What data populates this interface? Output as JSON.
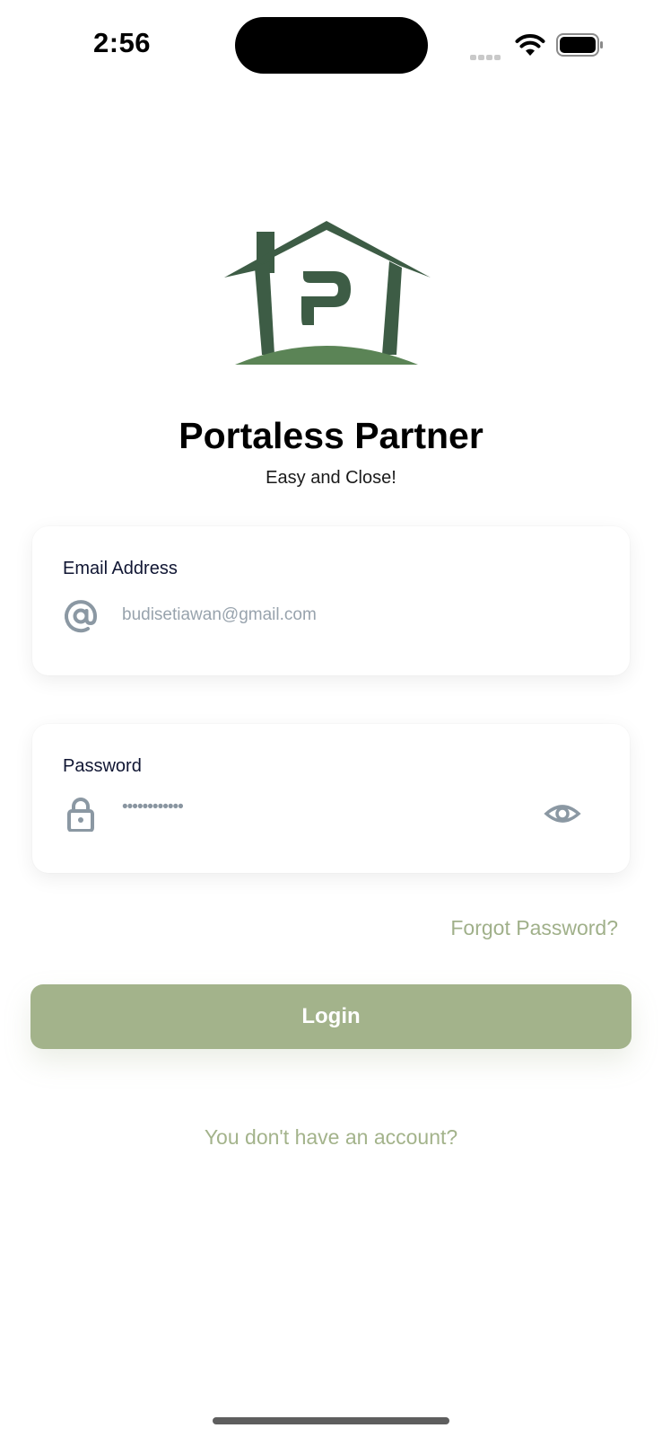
{
  "status_bar": {
    "time": "2:56",
    "wifi_icon": "wifi-icon",
    "battery_icon": "battery-icon"
  },
  "brand": {
    "title": "Portaless Partner",
    "tagline": "Easy and Close!",
    "logo_icon": "house-p-logo",
    "colors": {
      "dark_green": "#3d5c45",
      "light_green": "#5b8456",
      "accent": "#a3b38b"
    }
  },
  "email_field": {
    "label": "Email Address",
    "icon": "at-sign-icon",
    "value": "budisetiawan@gmail.com"
  },
  "password_field": {
    "label": "Password",
    "icon": "lock-icon",
    "value_masked": "••••••••••••",
    "toggle_icon": "eye-icon"
  },
  "forgot_password": "Forgot Password?",
  "login_button": "Login",
  "signup_link": "You don't have an account?"
}
